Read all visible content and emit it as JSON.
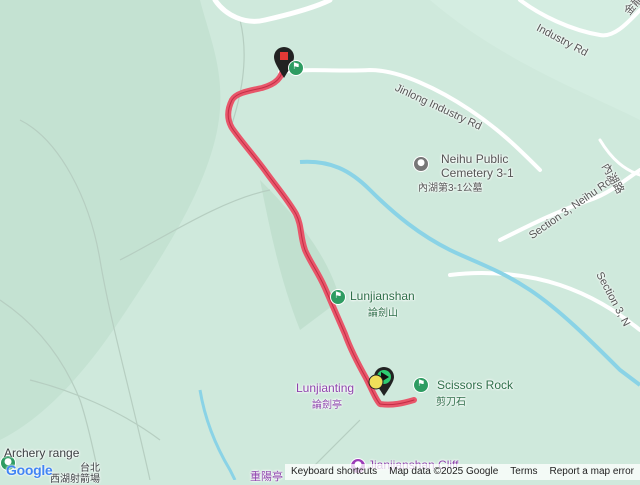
{
  "roads": {
    "industry_rd_top": "Industry Rd",
    "jinlong_industry_rd": "Jinlong Industry Rd",
    "section3_neihu_rd": "Section 3, Neihu Rd",
    "section3_right": "Section 3, N",
    "neihu_right_zh": "內湖路",
    "top_right_zh": "金龍"
  },
  "pois": {
    "cemetery_en_1": "Neihu Public",
    "cemetery_en_2": "Cemetery 3-1",
    "cemetery_zh": "內湖第3-1公墓",
    "lunjianshan_en": "Lunjianshan",
    "lunjianshan_zh": "論劍山",
    "lunjianting_en": "Lunjianting",
    "lunjianting_zh": "論劍亭",
    "scissors_en": "Scissors Rock",
    "scissors_zh": "剪刀石",
    "archery_en": "Archery range",
    "archery_zh_1": "台北",
    "archery_zh_2": "西湖射箭場",
    "cliff_en": "Jianjianshan Cliff",
    "bottom_zh": "重陽亭"
  },
  "footer": {
    "keyboard_shortcuts": "Keyboard shortcuts",
    "map_data": "Map data ©2025 Google",
    "terms": "Terms",
    "report": "Report a map error"
  },
  "logo": "Google",
  "colors": {
    "map_bg": "#cfe9dc",
    "route": "#e8566a",
    "river": "#8ad3e6",
    "road": "#ffffff",
    "poi_green": "#2e9c62"
  },
  "icons": {
    "start_marker": "green-flag-pin-icon",
    "end_marker": "red-square-pin-icon",
    "hiking_poi": "hiker-icon",
    "cemetery_poi": "cemetery-icon"
  }
}
